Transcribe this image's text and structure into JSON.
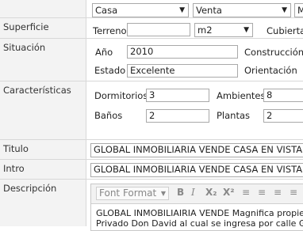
{
  "top_selects": {
    "tipo": "Casa",
    "operacion": "Venta",
    "extra": "M"
  },
  "superficie": {
    "label": "Superficie",
    "terreno_label": "Terreno",
    "terreno_value": "",
    "unit": "m2",
    "cubierta_label": "Cubierta"
  },
  "situacion": {
    "label": "Situación",
    "anio_label": "Año",
    "anio_value": "2010",
    "construccion_label": "Construcción",
    "estado_label": "Estado",
    "estado_value": "Excelente",
    "orientacion_label": "Orientación"
  },
  "caracteristicas": {
    "label": "Características",
    "dormitorios_label": "Dormitorios",
    "dormitorios_value": "3",
    "ambientes_label": "Ambientes",
    "ambientes_value": "8",
    "banos_label": "Baños",
    "banos_value": "2",
    "plantas_label": "Plantas",
    "plantas_value": "2"
  },
  "titulo": {
    "label": "Titulo",
    "value": "GLOBAL INMOBILIARIA VENDE CASA EN VISTALBA"
  },
  "intro": {
    "label": "Intro",
    "value": "GLOBAL INMOBILIARIA VENDE CASA EN VISTALBA"
  },
  "descripcion": {
    "label": "Descripción",
    "toolbar": {
      "format": "Font Format",
      "bold": "B",
      "italic": "I",
      "sub": "X₂",
      "sup": "X²"
    },
    "line1": "GLOBAL INMOBILIAIRIA VENDE Magnifica propiedad",
    "line2": "Privado Don David al cual se ingresa por calle Guardia"
  },
  "icons": [
    "chevron-down-icon",
    "bold-icon",
    "italic-icon",
    "subscript-icon",
    "superscript-icon",
    "align-left-icon",
    "align-center-icon",
    "align-right-icon",
    "align-justify-icon"
  ]
}
